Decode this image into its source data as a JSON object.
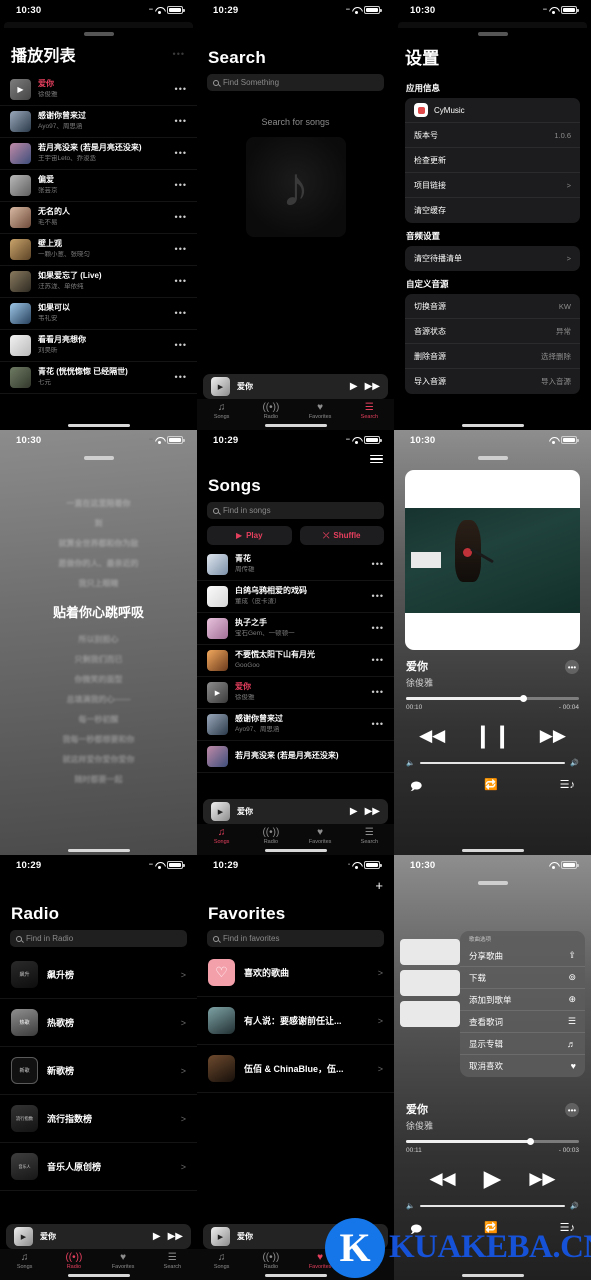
{
  "status": {
    "time_1030": "10:30",
    "time_1029": "10:29",
    "wifi_icon": "wifi-icon",
    "battery_icon": "battery-icon",
    "signal_icon": "signal-icon"
  },
  "tabbar": {
    "items": [
      {
        "label": "Songs",
        "icon": "music-note-icon"
      },
      {
        "label": "Radio",
        "icon": "radio-wave-icon"
      },
      {
        "label": "Favorites",
        "icon": "heart-icon"
      },
      {
        "label": "Search",
        "icon": "search-list-icon"
      }
    ]
  },
  "mini_player": {
    "title": "爱你",
    "play_icon": "play-icon",
    "next_icon": "forward-icon"
  },
  "playlist_panel": {
    "title": "播放列表",
    "more_icon": "ellipsis-icon",
    "songs": [
      {
        "title": "爱你",
        "artist": "徐俊雅",
        "active": true
      },
      {
        "title": "感谢你曾来过",
        "artist": "Ayo97、周思涵",
        "active": false
      },
      {
        "title": "若月亮没来 (若是月亮还没来)",
        "artist": "王宇宙Leto、乔浚丞",
        "active": false
      },
      {
        "title": "偏爱",
        "artist": "张芸京",
        "active": false
      },
      {
        "title": "无名的人",
        "artist": "毛不易",
        "active": false
      },
      {
        "title": "壁上观",
        "artist": "一颗小葱、张晓匀",
        "active": false
      },
      {
        "title": "如果爱忘了 (Live)",
        "artist": "汪苏泷、单依纯",
        "active": false
      },
      {
        "title": "如果可以",
        "artist": "韦礼安",
        "active": false
      },
      {
        "title": "看看月亮想你",
        "artist": "刘昊昕",
        "active": false
      },
      {
        "title": "青花 (恍恍惚惚 已经隔世)",
        "artist": "七元",
        "active": false
      }
    ]
  },
  "search_panel": {
    "title": "Search",
    "search_placeholder": "Find Something",
    "empty_text": "Search for songs",
    "note_icon": "music-note-icon"
  },
  "settings_panel": {
    "title": "设置",
    "sections": [
      {
        "heading": "应用信息",
        "rows": [
          {
            "label": "CyMusic",
            "value": "",
            "icon": "app-icon",
            "chevron": false
          },
          {
            "label": "版本号",
            "value": "1.0.6",
            "chevron": false
          },
          {
            "label": "检查更新",
            "value": "",
            "chevron": false
          },
          {
            "label": "项目链接",
            "value": "",
            "chevron": true
          },
          {
            "label": "清空缓存",
            "value": "",
            "chevron": false
          }
        ]
      },
      {
        "heading": "音频设置",
        "rows": [
          {
            "label": "清空待播清单",
            "value": "",
            "chevron": true
          }
        ]
      },
      {
        "heading": "自定义音源",
        "rows": [
          {
            "label": "切换音源",
            "value": "KW",
            "chevron": false
          },
          {
            "label": "音源状态",
            "value": "异常",
            "chevron": false
          },
          {
            "label": "删除音源",
            "value": "选择删除",
            "chevron": false
          },
          {
            "label": "导入音源",
            "value": "导入音源",
            "chevron": false
          }
        ]
      }
    ]
  },
  "lyrics_panel": {
    "lines_before": [
      "一直在这里陪着你",
      "到",
      "就算全世界都和你为敌",
      "愿做你的人、最亲近的",
      "我只上眼睛"
    ],
    "current_line": "贴着你心跳呼吸",
    "lines_after": [
      "所以别担心",
      "只剩我们而已",
      "你微笑的面型",
      "总填满我的心——",
      "每一秒初醒",
      "我每一秒都想要和你",
      "就这样爱你爱你爱你",
      "随时都要一起"
    ]
  },
  "songs_panel": {
    "title": "Songs",
    "menu_icon": "hamburger-icon",
    "search_placeholder": "Find in songs",
    "play_button": "Play",
    "play_icon": "play-icon",
    "shuffle_button": "Shuffle",
    "shuffle_icon": "shuffle-icon",
    "songs": [
      {
        "title": "青花",
        "artist": "周传雄",
        "active": false
      },
      {
        "title": "白鸽乌鸦相爱的戏码",
        "artist": "董成（皮卡渣）",
        "active": false
      },
      {
        "title": "执子之手",
        "artist": "宝石Gem、一顿顿一",
        "active": false
      },
      {
        "title": "不要慌太阳下山有月光",
        "artist": "GooGoo",
        "active": false
      },
      {
        "title": "爱你",
        "artist": "徐俊雅",
        "active": true
      },
      {
        "title": "感谢你曾来过",
        "artist": "Ayo97、周思涵",
        "active": false
      },
      {
        "title": "若月亮没来 (若是月亮还没来)",
        "artist": "",
        "active": false
      }
    ]
  },
  "player_panel": {
    "title": "爱你",
    "artist": "徐俊雅",
    "more_icon": "ellipsis-icon",
    "elapsed": "00:10",
    "remaining": "- 00:04",
    "progress_pct": 68,
    "prev_icon": "rewind-icon",
    "playpause_icon": "pause-icon",
    "next_icon": "forward-icon",
    "volume_low_icon": "volume-low-icon",
    "volume_high_icon": "volume-high-icon",
    "volume_pct": 100,
    "bottom_icons": [
      "lyrics-icon",
      "repeat-icon",
      "queue-icon"
    ]
  },
  "radio_panel": {
    "title": "Radio",
    "search_placeholder": "Find in Radio",
    "items": [
      {
        "label": "飙升榜",
        "chevron_icon": "chevron-right-icon"
      },
      {
        "label": "热歌榜",
        "chevron_icon": "chevron-right-icon"
      },
      {
        "label": "新歌榜",
        "chevron_icon": "chevron-right-icon"
      },
      {
        "label": "流行指数榜",
        "chevron_icon": "chevron-right-icon"
      },
      {
        "label": "音乐人原创榜",
        "chevron_icon": "chevron-right-icon"
      }
    ]
  },
  "favorites_panel": {
    "title": "Favorites",
    "search_placeholder": "Find in favorites",
    "add_icon": "plus-icon",
    "items": [
      {
        "label": "喜欢的歌曲",
        "chevron_icon": "chevron-right-icon",
        "heart": true
      },
      {
        "label": "有人说：要感谢前任让...",
        "chevron_icon": "chevron-right-icon",
        "heart": false
      },
      {
        "label": "伍佰 & ChinaBlue，伍...",
        "chevron_icon": "chevron-right-icon",
        "heart": false
      }
    ]
  },
  "context_menu_panel": {
    "menu_header": "歌曲选项",
    "items": [
      {
        "label": "分享歌曲",
        "icon": "share-icon",
        "glyph": "⇪"
      },
      {
        "label": "下载",
        "icon": "download-icon",
        "glyph": "⊛"
      },
      {
        "label": "添加到歌单",
        "icon": "add-circle-icon",
        "glyph": "⊕"
      },
      {
        "label": "查看歌词",
        "icon": "lyrics-icon",
        "glyph": "☰"
      },
      {
        "label": "显示专辑",
        "icon": "album-icon",
        "glyph": "♬"
      },
      {
        "label": "取消喜欢",
        "icon": "heart-filled-icon",
        "glyph": "♥"
      }
    ],
    "title": "爱你",
    "artist": "徐俊雅",
    "elapsed": "00:11",
    "remaining": "- 00:03",
    "progress_pct": 72,
    "more_icon": "ellipsis-icon",
    "prev_icon": "rewind-icon",
    "playpause_icon": "play-icon",
    "next_icon": "forward-icon"
  },
  "watermark": {
    "badge": "K",
    "text": "KUAKEBA.CN",
    "color": "#1652d8"
  }
}
